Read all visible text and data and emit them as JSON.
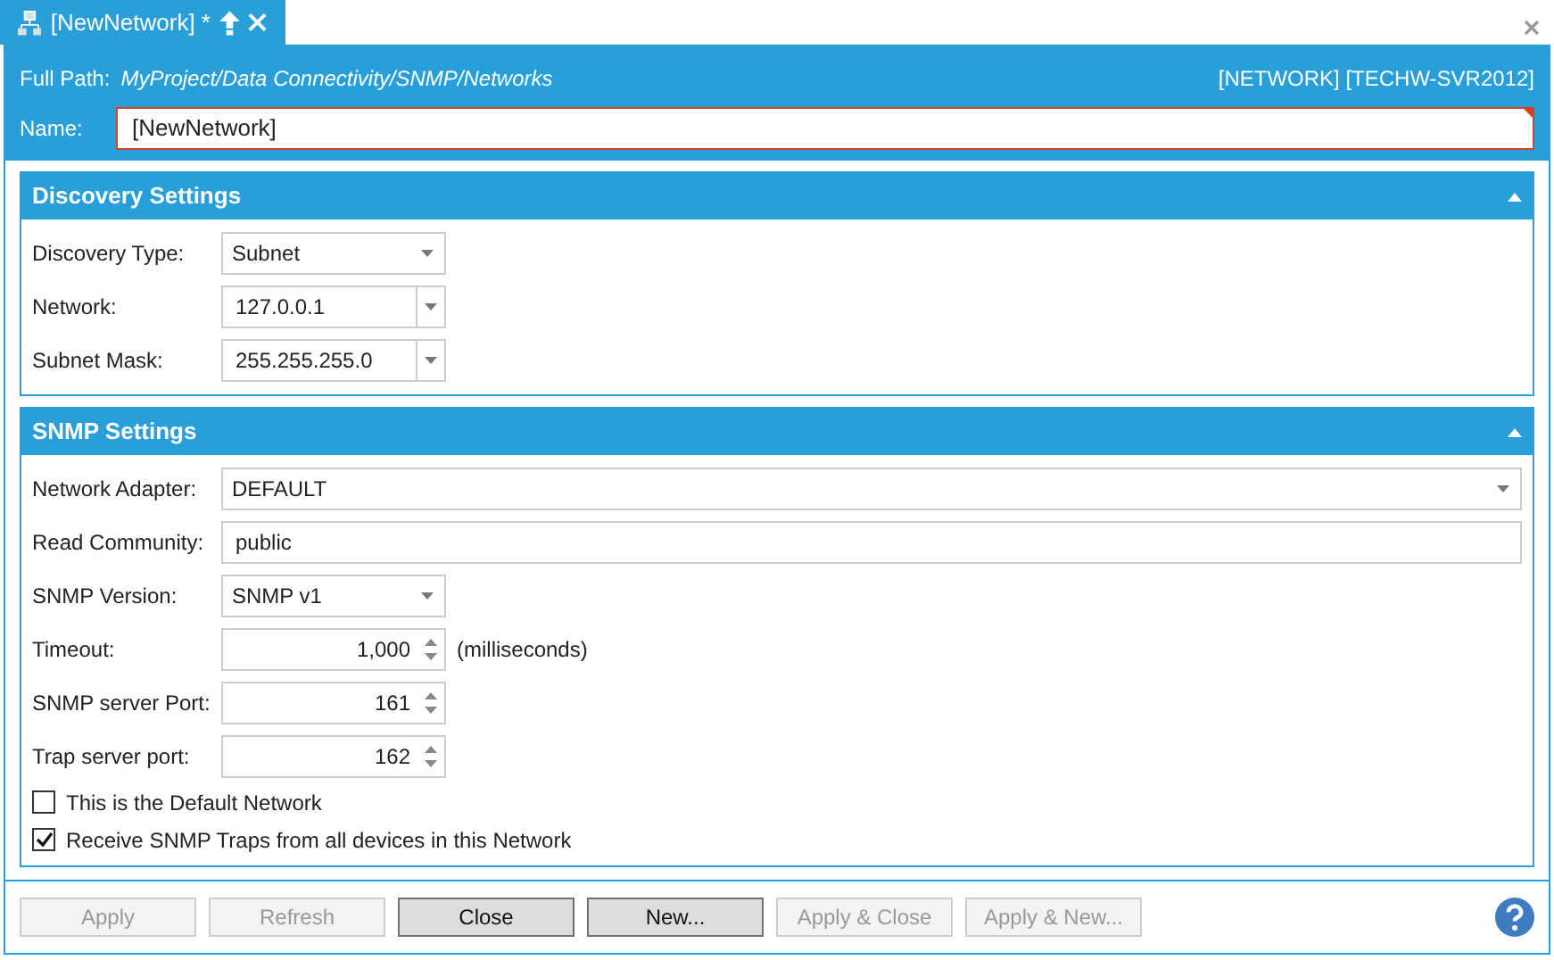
{
  "tab": {
    "title": "[NewNetwork] *"
  },
  "header": {
    "path_label": "Full Path:",
    "path": "MyProject/Data Connectivity/SNMP/Networks",
    "object": "[NETWORK] [TECHW-SVR2012]",
    "name_label": "Name:",
    "name_value": "[NewNetwork]"
  },
  "sections": [
    {
      "title": "Discovery Settings",
      "expanded": true,
      "rows": [
        {
          "kind": "dropdown",
          "label": "Discovery Type:",
          "value": "Subnet"
        },
        {
          "kind": "combo",
          "label": "Network:",
          "value": "127.0.0.1"
        },
        {
          "kind": "combo",
          "label": "Subnet Mask:",
          "value": "255.255.255.0"
        }
      ]
    },
    {
      "title": "SNMP Settings",
      "expanded": true,
      "rows": [
        {
          "kind": "wide-dropdown",
          "label": "Network Adapter:",
          "value": "DEFAULT"
        },
        {
          "kind": "text",
          "label": "Read Community:",
          "value": "public"
        },
        {
          "kind": "dropdown",
          "label": "SNMP Version:",
          "value": "SNMP v1"
        },
        {
          "kind": "spinner",
          "label": "Timeout:",
          "value": "1,000",
          "unit": "(milliseconds)"
        },
        {
          "kind": "spinner",
          "label": "SNMP server Port:",
          "value": "161"
        },
        {
          "kind": "spinner",
          "label": "Trap server port:",
          "value": "162"
        },
        {
          "kind": "checkbox",
          "label": "This is the Default Network",
          "checked": false
        },
        {
          "kind": "checkbox",
          "label": "Receive SNMP Traps from all devices in this Network",
          "checked": true
        }
      ]
    }
  ],
  "buttons": [
    {
      "label": "Apply",
      "disabled": true
    },
    {
      "label": "Refresh",
      "disabled": true
    },
    {
      "label": "Close",
      "disabled": false
    },
    {
      "label": "New...",
      "disabled": false
    },
    {
      "label": "Apply & Close",
      "disabled": true
    },
    {
      "label": "Apply & New...",
      "disabled": true
    }
  ]
}
